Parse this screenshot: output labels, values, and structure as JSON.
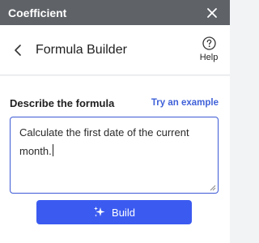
{
  "app": {
    "title": "Coefficient"
  },
  "header": {
    "title": "Formula Builder",
    "help_label": "Help"
  },
  "form": {
    "section_label": "Describe the formula",
    "try_example_link": "Try an example",
    "input_value": "Calculate the first date of the current month."
  },
  "actions": {
    "build_label": "Build"
  },
  "colors": {
    "titlebar": "#5f6368",
    "accent": "#3b5bf0",
    "link": "#3f61d8",
    "input_border": "#3d5ad6"
  },
  "icons": {
    "close": "close-icon",
    "back": "chevron-left-icon",
    "help": "question-circle-icon",
    "build": "sparkle-icon"
  }
}
